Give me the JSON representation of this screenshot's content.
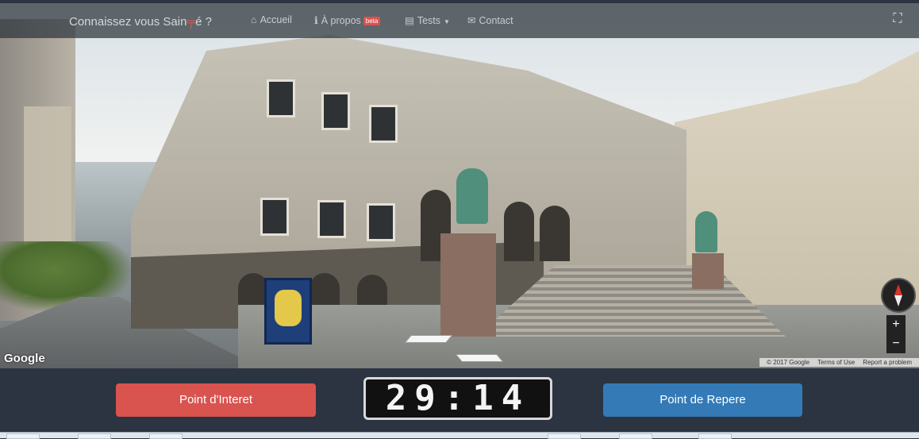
{
  "navbar": {
    "brand_prefix": "Connaissez vous Sain",
    "brand_cross": "╤",
    "brand_suffix": "é ?",
    "items": [
      {
        "icon": "home-icon",
        "glyph": "⌂",
        "label": "Accueil"
      },
      {
        "icon": "info-icon",
        "glyph": "ℹ",
        "label": "À propos",
        "badge": "beta"
      },
      {
        "icon": "list-icon",
        "glyph": "▤",
        "label": "Tests",
        "dropdown": true
      },
      {
        "icon": "envelope-icon",
        "glyph": "✉",
        "label": "Contact"
      }
    ],
    "fullscreen_glyph": "⛶"
  },
  "streetview": {
    "logo": "Google",
    "copyright": "© 2017 Google",
    "terms": "Terms of Use",
    "report": "Report a problem",
    "zoom_in": "+",
    "zoom_out": "−"
  },
  "controls": {
    "poi_button": "Point d'Interet",
    "timer": "29:14",
    "landmark_button": "Point de Repere"
  },
  "colors": {
    "poi_button": "#d9534f",
    "landmark_button": "#337ab7",
    "background": "#2b3440"
  }
}
